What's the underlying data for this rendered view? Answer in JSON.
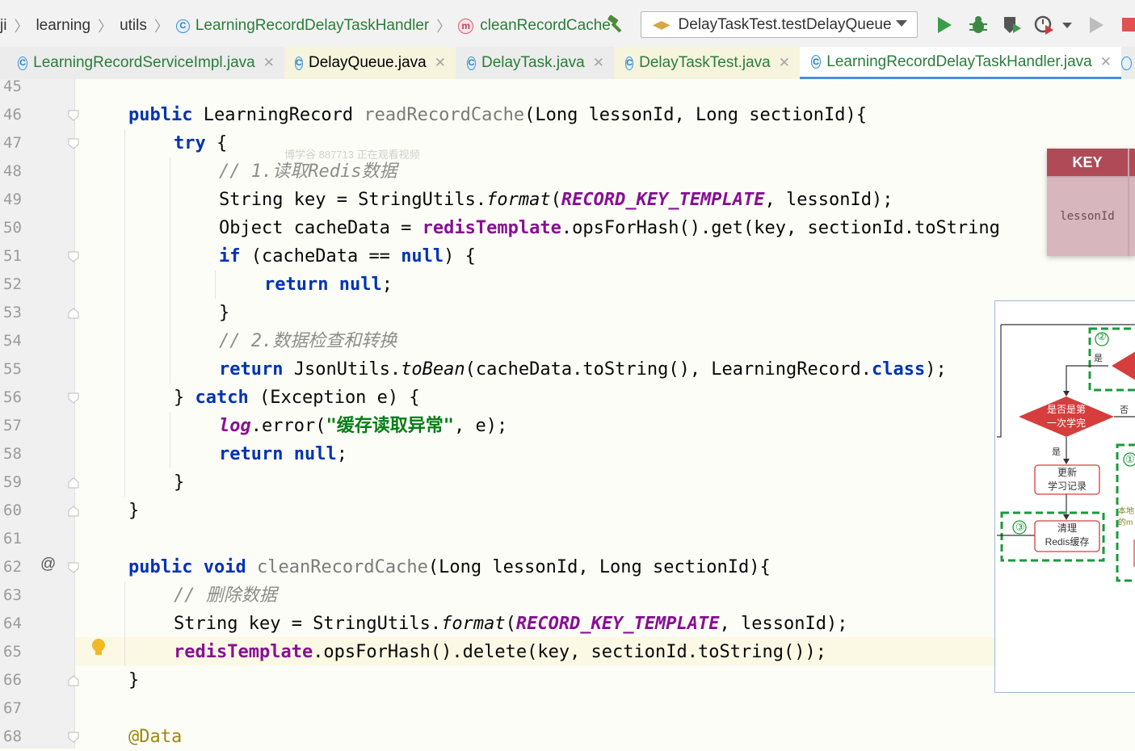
{
  "toolbar": {
    "breadcrumb": [
      "ji",
      "learning",
      "utils",
      "LearningRecordDelayTaskHandler",
      "cleanRecordCache"
    ],
    "run_config": "DelayTaskTest.testDelayQueue"
  },
  "tabs": [
    {
      "label": "LearningRecordServiceImpl.java"
    },
    {
      "label": "DelayQueue.java"
    },
    {
      "label": "DelayTask.java"
    },
    {
      "label": "DelayTaskTest.java"
    },
    {
      "label": "LearningRecordDelayTaskHandler.java"
    }
  ],
  "line_numbers": [
    "45",
    "46",
    "47",
    "48",
    "49",
    "50",
    "51",
    "52",
    "53",
    "54",
    "55",
    "56",
    "57",
    "58",
    "59",
    "60",
    "61",
    "62",
    "63",
    "64",
    "65",
    "66",
    "67",
    "68"
  ],
  "code": {
    "l46": {
      "kw1": "public",
      "type": " LearningRecord ",
      "method": "readRecordCache",
      "rest": "(Long lessonId, Long sectionId){"
    },
    "l47": {
      "kw": "try",
      "rest": " {"
    },
    "l48": {
      "comment": "// 1.读取Redis数据"
    },
    "l49": {
      "a": "String key = StringUtils.",
      "b": "format",
      "c": "(",
      "d": "RECORD_KEY_TEMPLATE",
      "e": ", lessonId);"
    },
    "l50": {
      "a": "Object cacheData = ",
      "b": "redisTemplate",
      "c": ".opsForHash().get(key, sectionId.toString"
    },
    "l51": {
      "kw": "if",
      "a": " (cacheData == ",
      "kw2": "null",
      "b": ") {"
    },
    "l52": {
      "kw": "return",
      "a": " ",
      "kw2": "null",
      "b": ";"
    },
    "l53": {
      "a": "}"
    },
    "l54": {
      "comment": "// 2.数据检查和转换"
    },
    "l55": {
      "kw": "return",
      "a": " JsonUtils.",
      "b": "toBean",
      "c": "(cacheData.toString(), LearningRecord.",
      "kw2": "class",
      "d": ");"
    },
    "l56": {
      "a": "} ",
      "kw": "catch",
      "b": " (Exception e) {"
    },
    "l57": {
      "log": "log",
      "a": ".error(",
      "str": "\"缓存读取异常\"",
      "b": ", e);"
    },
    "l58": {
      "kw": "return",
      "a": " ",
      "kw2": "null",
      "b": ";"
    },
    "l59": {
      "a": "}"
    },
    "l60": {
      "a": "}"
    },
    "l62": {
      "kw1": "public",
      "a": " ",
      "kw2": "void",
      "b": " ",
      "method": "cleanRecordCache",
      "c": "(Long lessonId, Long sectionId){"
    },
    "l63": {
      "comment": "// 删除数据"
    },
    "l64": {
      "a": "String key = StringUtils.",
      "b": "format",
      "c": "(",
      "d": "RECORD_KEY_TEMPLATE",
      "e": ", lessonId);"
    },
    "l65": {
      "a": "redisTemplate",
      "b": ".opsForHash().delete(key, sectionId.toString());"
    },
    "l66": {
      "a": "}"
    },
    "l68": {
      "ann": "@Data"
    }
  },
  "watermark": "博学谷 887713 正在观看视频",
  "key_table": {
    "header": "KEY",
    "cell": "lessonId"
  },
  "flowchart": {
    "step2": "②",
    "yes_top": "是",
    "decision": [
      "是否是第",
      "一次学完"
    ],
    "no": "否",
    "yes": "是",
    "update": [
      "更新",
      "学习记录"
    ],
    "step3": "③",
    "clear": [
      "清理",
      "Redis缓存"
    ],
    "step1": "①",
    "side_text": [
      "本地",
      "的m"
    ]
  }
}
